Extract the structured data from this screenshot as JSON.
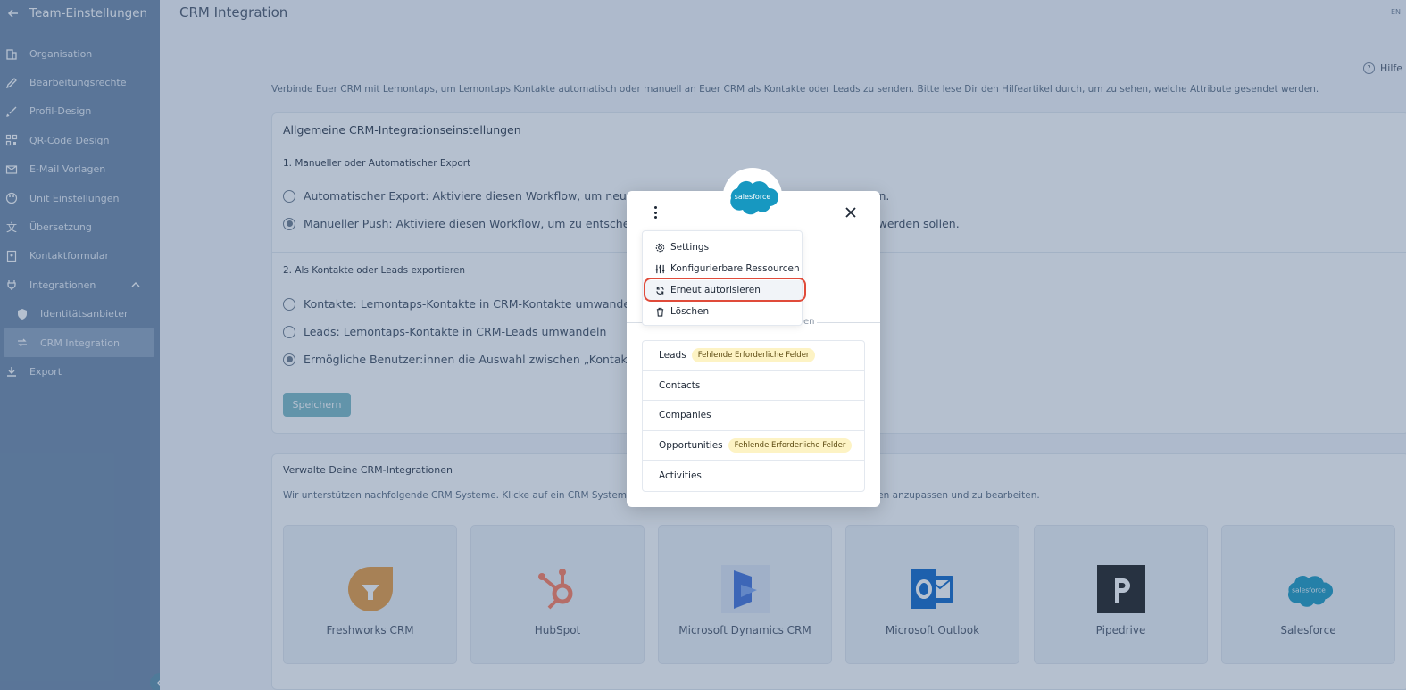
{
  "sidebar": {
    "title": "Team-Einstellungen",
    "items": [
      {
        "label": "Organisation",
        "icon": "building-icon"
      },
      {
        "label": "Bearbeitungsrechte",
        "icon": "pencil-icon"
      },
      {
        "label": "Profil-Design",
        "icon": "brush-icon"
      },
      {
        "label": "QR-Code Design",
        "icon": "qr-code-icon"
      },
      {
        "label": "E-Mail Vorlagen",
        "icon": "mail-icon"
      },
      {
        "label": "Unit Einstellungen",
        "icon": "palette-icon"
      },
      {
        "label": "Übersetzung",
        "icon": "translate-icon"
      },
      {
        "label": "Kontaktformular",
        "icon": "form-icon"
      },
      {
        "label": "Integrationen",
        "icon": "plug-icon"
      },
      {
        "label": "Identitätsanbieter",
        "icon": "shield-icon"
      },
      {
        "label": "CRM Integration",
        "icon": "crm-sync-icon"
      },
      {
        "label": "Export",
        "icon": "download-icon"
      }
    ]
  },
  "header": {
    "title": "CRM Integration",
    "lang": "EN"
  },
  "help": {
    "label": "Hilfe"
  },
  "intro": "Verbinde Euer CRM mit Lemontaps, um Lemontaps Kontakte automatisch oder manuell an Euer CRM als Kontakte oder Leads zu senden. Bitte lese Dir den Hilfeartikel durch, um zu sehen, welche Attribute gesendet werden.",
  "general": {
    "title": "Allgemeine CRM-Integrationseinstellungen",
    "section1": "1. Manueller oder Automatischer Export",
    "opt_auto": "Automatischer Export: Aktiviere diesen Workflow, um neue Kontakte automatisch in das CRM zu senden.",
    "opt_manual": "Manueller Push: Aktiviere diesen Workflow, um zu entscheiden, welche Kontakte in das CRM gesendet werden sollen.",
    "section2": "2. Als Kontakte oder Leads exportieren",
    "opt_contacts": "Kontakte: Lemontaps-Kontakte in CRM-Kontakte umwandeln",
    "opt_leads": "Leads: Lemontaps-Kontakte in CRM-Leads umwandeln",
    "opt_choice": "Ermögliche Benutzer:innen die Auswahl zwischen „Kontakt“ und „Lead“",
    "save": "Speichern"
  },
  "manage": {
    "title": "Verwalte Deine CRM-Integrationen",
    "subtitle": "Wir unterstützen nachfolgende CRM Systeme. Klicke auf ein CRM System, um die Integration zu konfigurieren oder Einstellungen anzupassen und zu bearbeiten.",
    "crms": [
      {
        "name": "Freshworks CRM",
        "color": "#e89a3c"
      },
      {
        "name": "HubSpot",
        "color": "#ff7a59"
      },
      {
        "name": "Microsoft Dynamics CRM",
        "color": "#3e6fd8"
      },
      {
        "name": "Microsoft Outlook",
        "color": "#0a64c8"
      },
      {
        "name": "Pipedrive",
        "color": "#1a1a1a"
      },
      {
        "name": "Salesforce",
        "color": "#1798c1"
      }
    ]
  },
  "modal": {
    "brand": "salesforce",
    "section_label": "en",
    "menu": [
      {
        "label": "Settings",
        "icon": "gear-icon"
      },
      {
        "label": "Konfigurierbare Ressourcen",
        "icon": "sliders-icon"
      },
      {
        "label": "Erneut autorisieren",
        "icon": "refresh-icon"
      },
      {
        "label": "Löschen",
        "icon": "trash-icon"
      }
    ],
    "resources": [
      {
        "label": "Leads",
        "tag": "Fehlende Erforderliche Felder"
      },
      {
        "label": "Contacts",
        "tag": ""
      },
      {
        "label": "Companies",
        "tag": ""
      },
      {
        "label": "Opportunities",
        "tag": "Fehlende Erforderliche Felder"
      },
      {
        "label": "Activities",
        "tag": ""
      }
    ]
  }
}
